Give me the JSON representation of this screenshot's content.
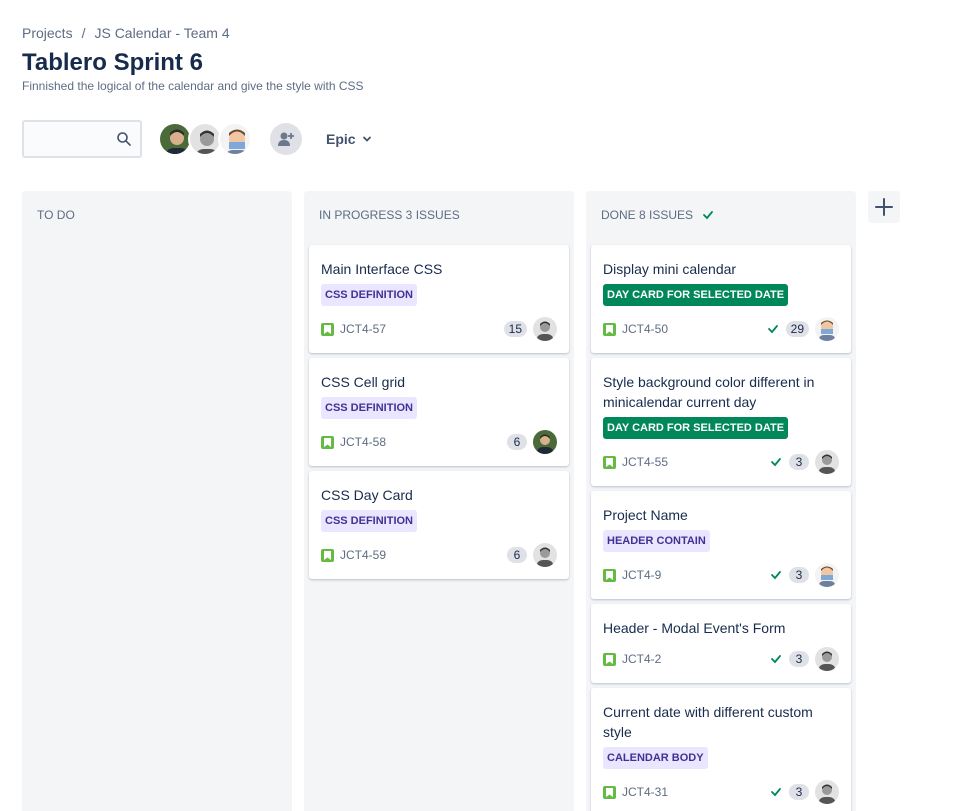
{
  "breadcrumb": {
    "items": [
      "Projects",
      "JS Calendar - Team 4"
    ],
    "separator": "/"
  },
  "page": {
    "title": "Tablero Sprint 6",
    "subtitle": "Finnished the logical of the calendar and give the style with CSS"
  },
  "toolbar": {
    "search_placeholder": "",
    "epic_label": "Epic"
  },
  "columns": [
    {
      "header": "TO DO",
      "cards": []
    },
    {
      "header": "IN PROGRESS 3 ISSUES",
      "cards": [
        {
          "title": "Main Interface CSS",
          "label": "CSS DEFINITION",
          "key": "JCT4-57",
          "points": "15",
          "assignee": "avatar-b"
        },
        {
          "title": "CSS Cell grid",
          "label": "CSS DEFINITION",
          "key": "JCT4-58",
          "points": "6",
          "assignee": "avatar-a"
        },
        {
          "title": "CSS Day Card",
          "label": "CSS DEFINITION",
          "key": "JCT4-59",
          "points": "6",
          "assignee": "avatar-b"
        }
      ]
    },
    {
      "header": "DONE 8 ISSUES",
      "cards": [
        {
          "title": "Display mini calendar",
          "label": "DAY CARD FOR SELECTED DATE",
          "key": "JCT4-50",
          "points": "29",
          "assignee": "avatar-c"
        },
        {
          "title": "Style background color different in minicalendar current day",
          "label": "DAY CARD FOR SELECTED DATE",
          "key": "JCT4-55",
          "points": "3",
          "assignee": "avatar-b"
        },
        {
          "title": "Project Name",
          "label": "HEADER CONTAIN",
          "key": "JCT4-9",
          "points": "3",
          "assignee": "avatar-c"
        },
        {
          "title": "Header - Modal Event's Form",
          "label": "",
          "key": "JCT4-2",
          "points": "3",
          "assignee": "avatar-b"
        },
        {
          "title": "Current date with different custom style",
          "label": "CALENDAR BODY",
          "key": "JCT4-31",
          "points": "3",
          "assignee": "avatar-b"
        }
      ]
    }
  ],
  "colors": {
    "accent_green": "#00875a",
    "story_green": "#65ba43",
    "label_purple_bg": "#eae6ff",
    "label_purple_text": "#403294",
    "column_bg": "#f4f5f7"
  },
  "icons": [
    "search-icon",
    "add-people-icon",
    "chevron-down-icon",
    "story-icon",
    "check-icon",
    "plus-icon"
  ]
}
